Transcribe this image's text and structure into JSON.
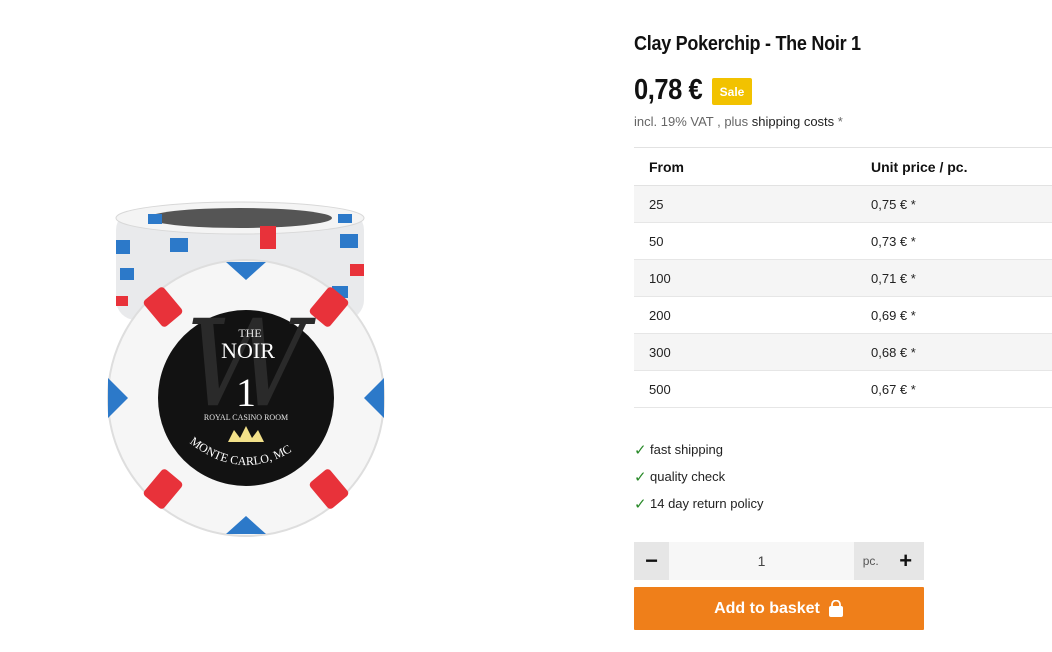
{
  "product": {
    "title": "Clay Pokerchip - The Noir 1",
    "price": "0,78 €",
    "sale_badge": "Sale",
    "vat_prefix": "incl. 19% VAT , plus ",
    "shipping_link": "shipping costs",
    "vat_suffix": " *"
  },
  "chip_image": {
    "brand_small": "THE",
    "brand": "NOIR",
    "value": "1",
    "room": "ROYAL CASINO ROOM",
    "location": "MONTE CARLO, MC"
  },
  "price_table": {
    "headers": [
      "From",
      "Unit price / pc."
    ],
    "rows": [
      {
        "from": "25",
        "price": "0,75 € *"
      },
      {
        "from": "50",
        "price": "0,73 € *"
      },
      {
        "from": "100",
        "price": "0,71 € *"
      },
      {
        "from": "200",
        "price": "0,69 € *"
      },
      {
        "from": "300",
        "price": "0,68 € *"
      },
      {
        "from": "500",
        "price": "0,67 € *"
      }
    ]
  },
  "features": [
    "fast shipping",
    "quality check",
    "14 day return policy"
  ],
  "quantity": {
    "minus": "−",
    "value": "1",
    "unit": "pc.",
    "plus": "+"
  },
  "basket_button": "Add to basket",
  "colors": {
    "sale": "#f2c200",
    "basket": "#ef7f1a",
    "check": "#2a8a2a",
    "chip_red": "#e8323a",
    "chip_blue": "#2c79c9"
  }
}
